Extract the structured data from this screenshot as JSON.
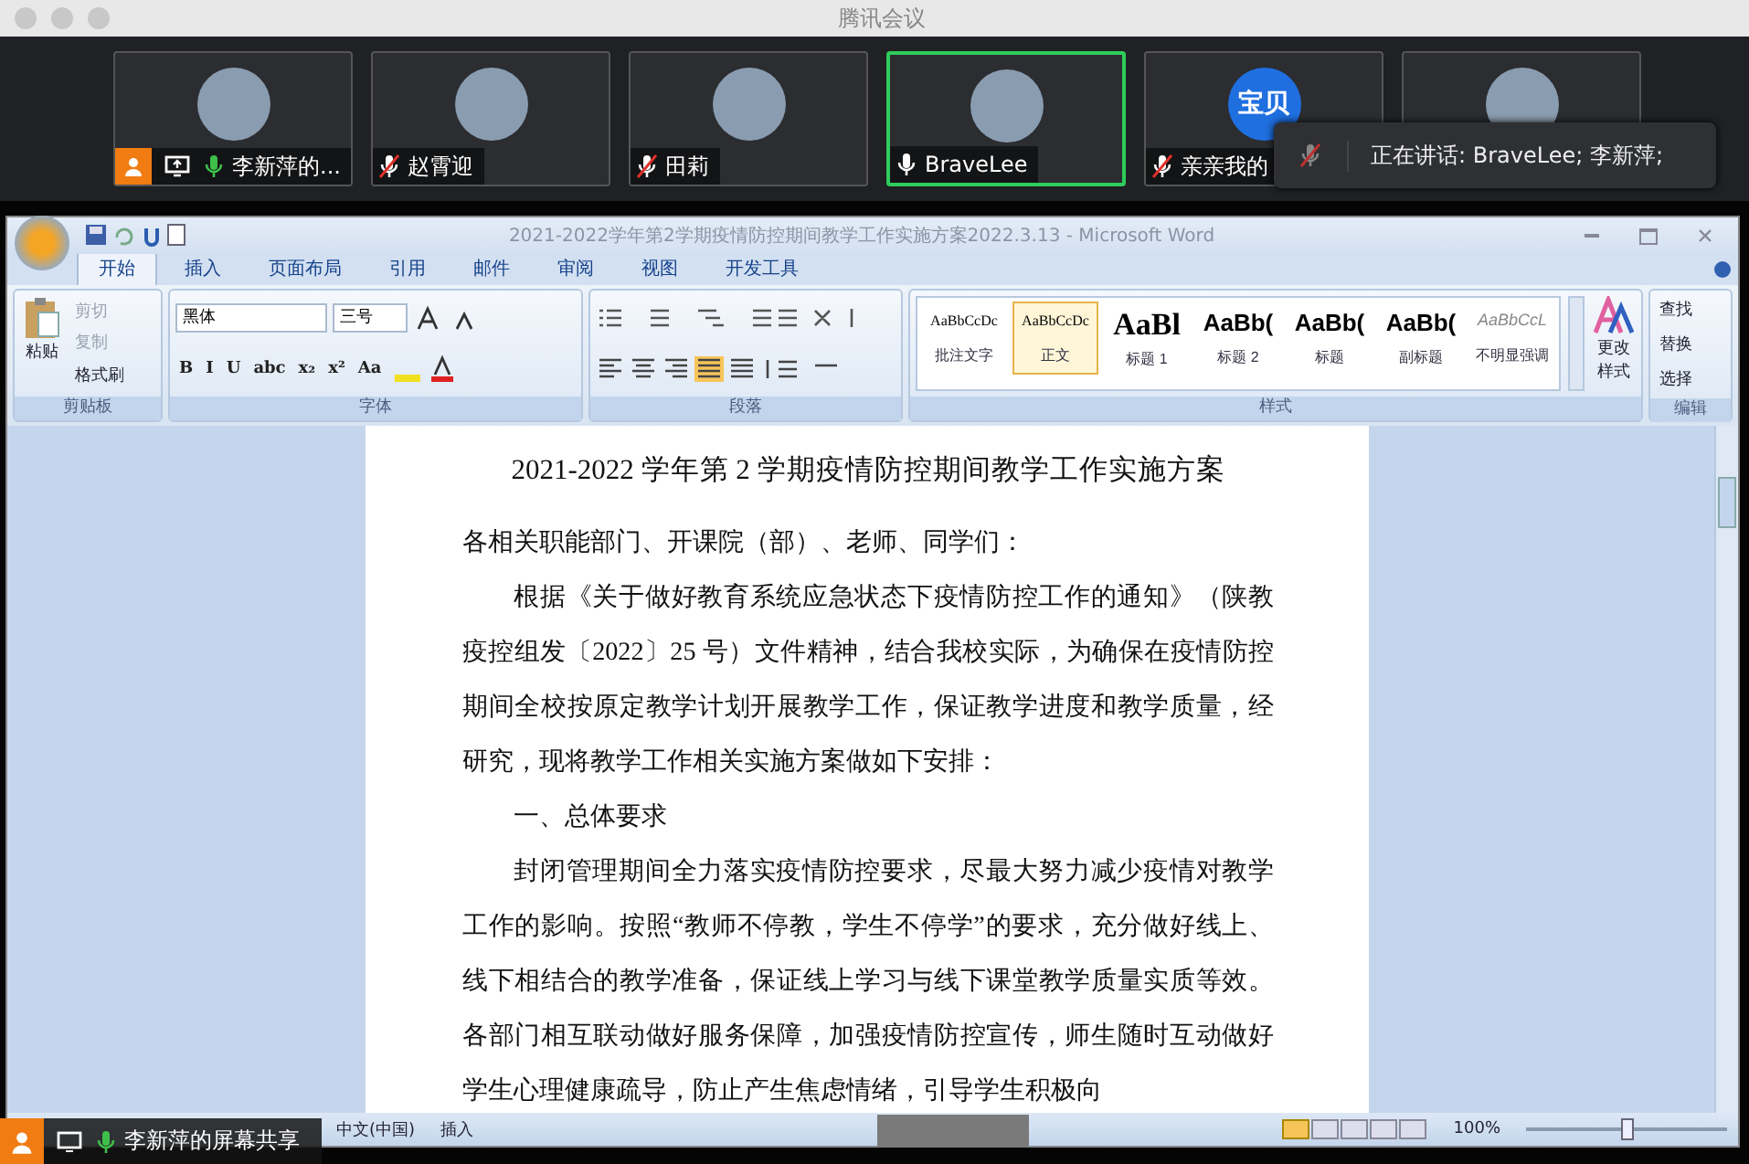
{
  "window": {
    "title": "腾讯会议"
  },
  "participants": [
    {
      "name": "李新萍的...",
      "muted": false,
      "voice_active": true,
      "host": true,
      "sharing": true,
      "speaking": false
    },
    {
      "name": "赵霄迎",
      "muted": true,
      "voice_active": false,
      "host": false,
      "sharing": false,
      "speaking": false
    },
    {
      "name": "田莉",
      "muted": true,
      "voice_active": false,
      "host": false,
      "sharing": false,
      "speaking": false
    },
    {
      "name": "BraveLee",
      "muted": false,
      "voice_active": false,
      "host": false,
      "sharing": false,
      "speaking": true
    },
    {
      "name": "亲亲我的",
      "muted": true,
      "voice_active": false,
      "host": false,
      "sharing": false,
      "speaking": false,
      "avatar_text": "宝贝"
    },
    {
      "speaking": false
    }
  ],
  "speaking_toast": {
    "text": "正在讲话: BraveLee; 李新萍;"
  },
  "word": {
    "title": "2021-2022学年第2学期疫情防控期间教学工作实施方案2022.3.13 - Microsoft Word",
    "tabs": [
      {
        "label": "开始",
        "selected": true
      },
      {
        "label": "插入",
        "selected": false
      },
      {
        "label": "页面布局",
        "selected": false
      },
      {
        "label": "引用",
        "selected": false
      },
      {
        "label": "邮件",
        "selected": false
      },
      {
        "label": "审阅",
        "selected": false
      },
      {
        "label": "视图",
        "selected": false
      },
      {
        "label": "开发工具",
        "selected": false
      }
    ],
    "clipboard": {
      "paste": "粘贴",
      "items": [
        {
          "label": "剪切",
          "disabled": true
        },
        {
          "label": "复制",
          "disabled": true
        },
        {
          "label": "格式刷",
          "disabled": false
        }
      ],
      "group": "剪贴板"
    },
    "font": {
      "family": "黑体",
      "size": "三号",
      "row2": [
        "B",
        "I",
        "U",
        "abc",
        "x₂",
        "x²",
        "Aa"
      ],
      "group": "字体"
    },
    "paragraph": {
      "group": "段落"
    },
    "styles": {
      "items": [
        {
          "preview": "AaBbCcDc",
          "label": "批注文字",
          "kind": "serif",
          "selected": false
        },
        {
          "preview": "AaBbCcDc",
          "label": "正文",
          "kind": "serif",
          "selected": true
        },
        {
          "preview": "AaBl",
          "label": "标题 1",
          "kind": "large",
          "selected": false
        },
        {
          "preview": "AaBb(",
          "label": "标题 2",
          "kind": "bold",
          "selected": false
        },
        {
          "preview": "AaBb(",
          "label": "标题",
          "kind": "bold",
          "selected": false
        },
        {
          "preview": "AaBb(",
          "label": "副标题",
          "kind": "bold",
          "selected": false
        },
        {
          "preview": "AaBbCcL",
          "label": "不明显强调",
          "kind": "italic",
          "selected": false
        }
      ],
      "change": "更改样式",
      "group": "样式"
    },
    "editing": {
      "items": [
        "查找",
        "替换",
        "选择"
      ],
      "group": "编辑"
    },
    "document": {
      "title": "2021-2022 学年第 2 学期疫情防控期间教学工作实施方案",
      "paragraphs": [
        {
          "kind": "plain",
          "text": "各相关职能部门、开课院（部）、老师、同学们："
        },
        {
          "kind": "indent",
          "text": "根据《关于做好教育系统应急状态下疫情防控工作的通知》（陕教疫控组发〔2022〕25 号）文件精神，结合我校实际，为确保在疫情防控期间全校按原定教学计划开展教学工作，保证教学进度和教学质量，经研究，现将教学工作相关实施方案做如下安排："
        },
        {
          "kind": "indent",
          "text": "一、总体要求"
        },
        {
          "kind": "indent",
          "text": "封闭管理期间全力落实疫情防控要求，尽最大努力减少疫情对教学工作的影响。按照“教师不停教，学生不停学”的要求，充分做好线上、线下相结合的教学准备，保证线上学习与线下课堂教学质量实质等效。各部门相互联动做好服务保障，加强疫情防控宣传，师生随时互动做好学生心理健康疏导，防止产生焦虑情绪，引导学生积极向"
        }
      ]
    },
    "status": {
      "language": "中文(中国)",
      "mode": "插入",
      "zoom": "100%",
      "zoom_slider": {
        "level": 0.5
      }
    }
  },
  "share_label": {
    "text": "李新萍的屏幕共享"
  }
}
